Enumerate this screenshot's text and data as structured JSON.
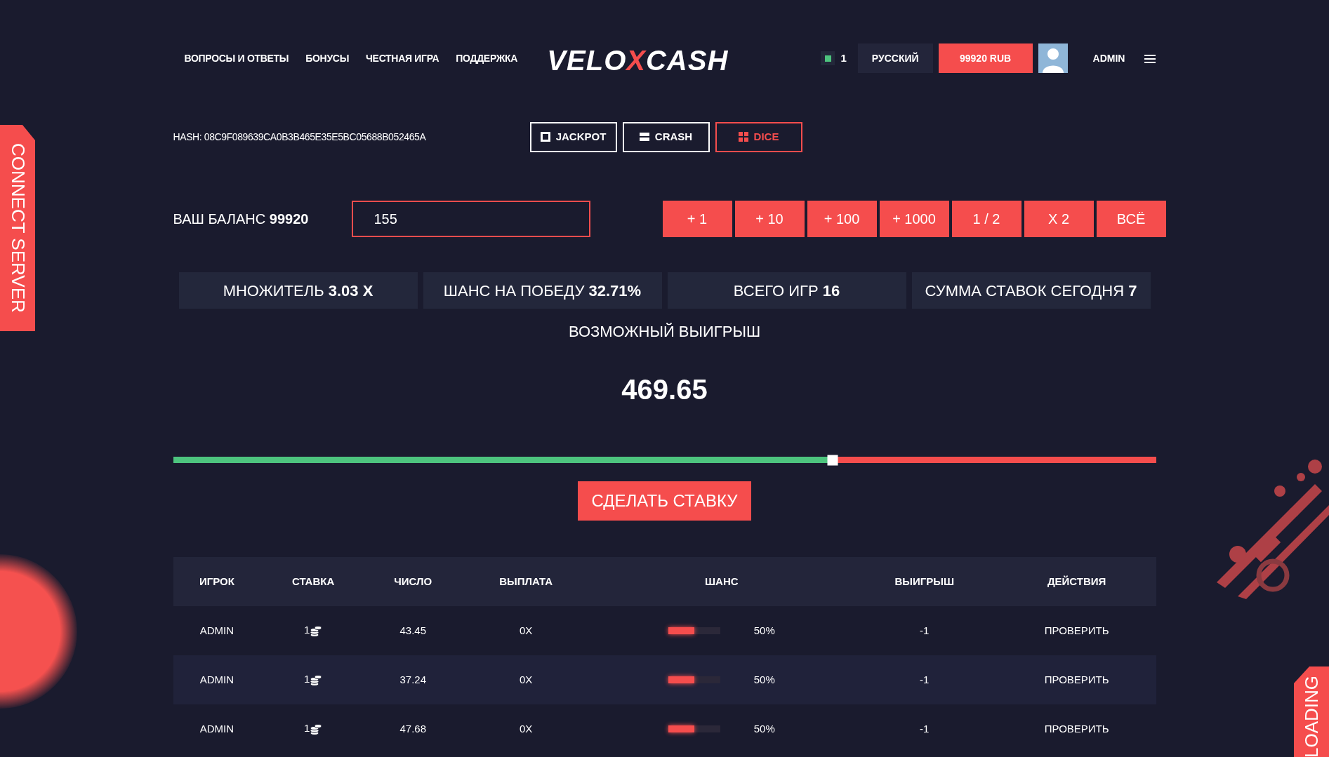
{
  "nav": [
    "ВОПРОСЫ И ОТВЕТЫ",
    "БОНУСЫ",
    "ЧЕСТНАЯ ИГРА",
    "ПОДДЕРЖКА"
  ],
  "logo": [
    {
      "text": "VELO",
      "accent": false
    },
    {
      "text": "X",
      "accent": true
    },
    {
      "text": "CASH",
      "accent": false
    }
  ],
  "online": {
    "count": "1"
  },
  "language": "РУССКИЙ",
  "balance_button": "99920 RUB",
  "username": "ADMIN",
  "hash": "HASH: 08C9F089639CA0B3B465E35E5BC05688B052465A",
  "games": [
    {
      "label": "JACKPOT",
      "kind": "single",
      "selected": false
    },
    {
      "label": "CRASH",
      "kind": "bars",
      "selected": false
    },
    {
      "label": "DICE",
      "kind": "grid",
      "selected": true
    }
  ],
  "balance": "ВАШ БАЛАНС **99920**",
  "bet_input": {
    "value": "155"
  },
  "amount_buttons": [
    "+ 1",
    "+ 10",
    "+ 100",
    "+ 1000",
    "1 / 2",
    "X 2",
    "ВСЁ"
  ],
  "stats": [
    "МНОЖИТЕЛЬ **3.03 X**",
    "ШАНС НА ПОБЕДУ **32.71%**",
    "ВСЕГО ИГР **16**",
    "СУММА СТАВОК СЕГОДНЯ **7**"
  ],
  "possible_win": {
    "label": "ВОЗМОЖНЫЙ ВЫИГРЫШ",
    "value": "469.65"
  },
  "slider": {
    "level": 0.671
  },
  "bet_button": "СДЕЛАТЬ СТАВКУ",
  "table": {
    "columns": [
      "ИГРОК",
      "СТАВКА",
      "ЧИСЛО",
      "ВЫПЛАТА",
      "ШАНС",
      "ВЫИГРЫШ",
      "ДЕЙСТВИЯ"
    ],
    "rows": [
      {
        "player": "ADMIN",
        "bet": "1",
        "number": "43.45",
        "payout": "0X",
        "chance": {
          "level": 0.5,
          "text": "50%"
        },
        "win": "-1",
        "action": "ПРОВЕРИТЬ"
      },
      {
        "player": "ADMIN",
        "bet": "1",
        "number": "37.24",
        "payout": "0X",
        "chance": {
          "level": 0.5,
          "text": "50%"
        },
        "win": "-1",
        "action": "ПРОВЕРИТЬ"
      },
      {
        "player": "ADMIN",
        "bet": "1",
        "number": "47.68",
        "payout": "0X",
        "chance": {
          "level": 0.5,
          "text": "50%"
        },
        "win": "-1",
        "action": "ПРОВЕРИТЬ"
      }
    ]
  },
  "side_tabs": {
    "left": "CONNECT SERVER",
    "right": "LOADING"
  }
}
